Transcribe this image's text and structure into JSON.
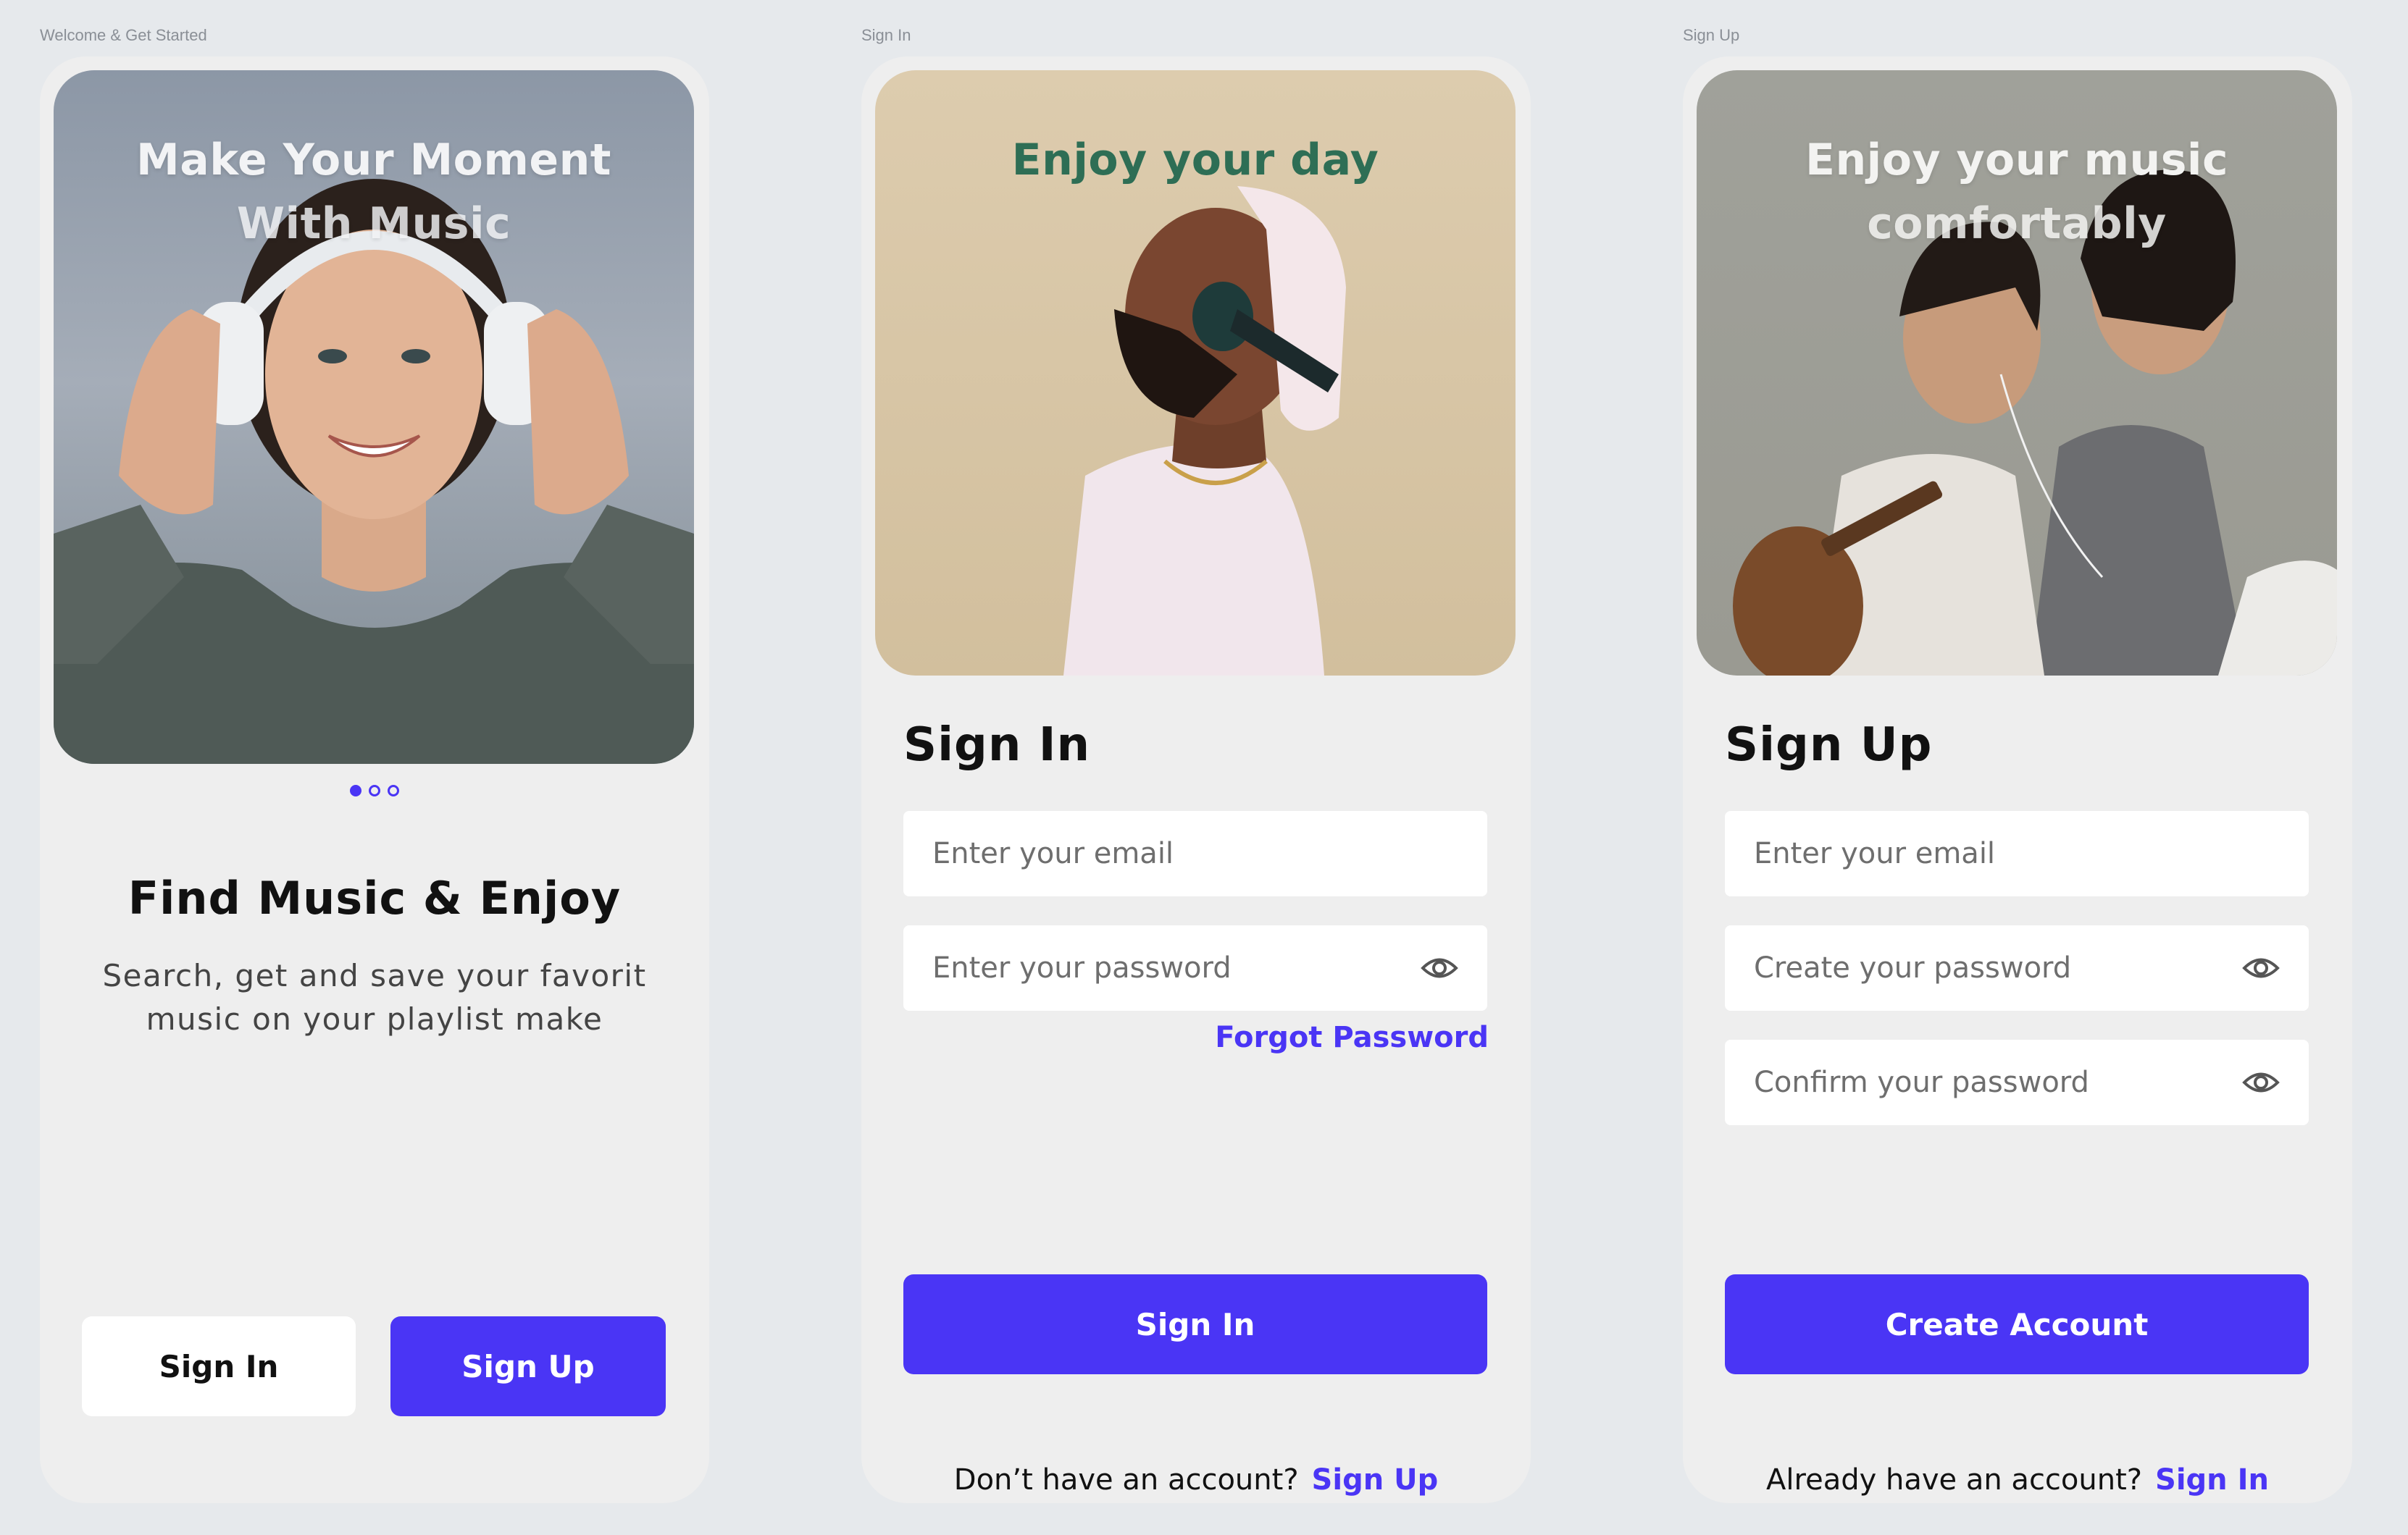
{
  "frames": [
    {
      "label": "Welcome & Get Started",
      "hero_title_line1": "Make Your Moment",
      "hero_title_line2": "With Music",
      "carousel": {
        "pages": 3,
        "active": 1
      },
      "heading": "Find Music & Enjoy",
      "subtext_line1": "Search, get and save your favorit",
      "subtext_line2": "music on your playlist make",
      "sign_in_label": "Sign In",
      "sign_up_label": "Sign Up"
    },
    {
      "label": "Sign In",
      "hero_title": "Enjoy your day",
      "title": "Sign In",
      "email_placeholder": "Enter your email",
      "password_placeholder": "Enter your password",
      "forgot_label": "Forgot Password",
      "submit_label": "Sign In",
      "footer_text": "Don’t have an account?",
      "footer_link": "Sign Up"
    },
    {
      "label": "Sign Up",
      "hero_title_line1": "Enjoy your music",
      "hero_title_line2": "comfortably",
      "title": "Sign Up",
      "email_placeholder": "Enter your email",
      "create_password_placeholder": "Create your password",
      "confirm_password_placeholder": "Confirm your password",
      "submit_label": "Create Account",
      "footer_text": "Already have an account?",
      "footer_link": "Sign In"
    }
  ],
  "icons": {
    "password_toggle": "eye-icon"
  },
  "colors": {
    "accent": "#4a35f5",
    "canvas": "#e6e9ec",
    "card": "#eeeeee",
    "hero_welcome": "#8f9aa8",
    "hero_signin": "#d8c6a6",
    "hero_signup": "#9d9e97",
    "title_signin": "#2e6e55"
  }
}
